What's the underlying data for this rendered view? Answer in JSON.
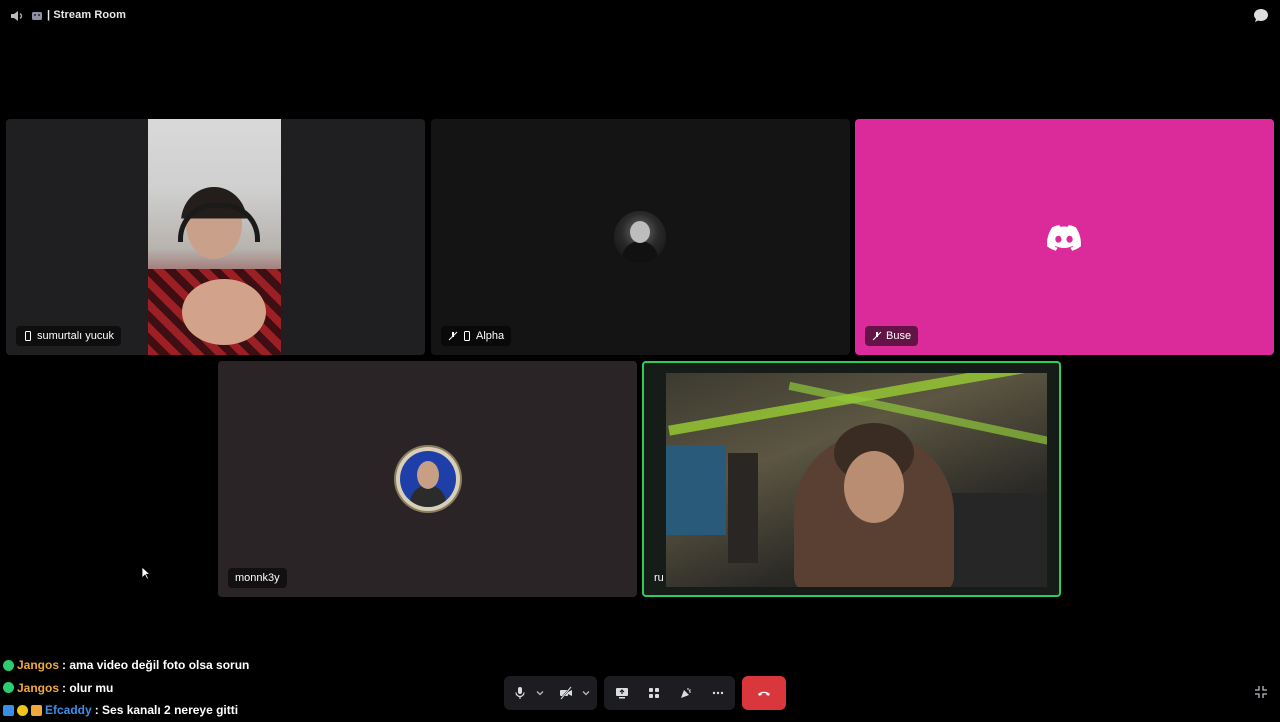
{
  "header": {
    "title": "| Stream Room"
  },
  "tiles": [
    {
      "name": "sumurtalı yucuk",
      "device": "mobile",
      "muted": false
    },
    {
      "name": "Alpha",
      "device": "mobile",
      "muted": true
    },
    {
      "name": "Buse",
      "muted": true
    },
    {
      "name": "monnk3y",
      "muted": false
    },
    {
      "name": "ru",
      "speaking": true
    }
  ],
  "colors": {
    "discord_pink": "#db2b9a",
    "speaking_ring": "#2ecc5c",
    "hangup": "#da373c"
  },
  "chat": [
    {
      "author": "Jangos",
      "author_color": "#f0a83a",
      "message": ": ama video değil foto olsa sorun"
    },
    {
      "author": "Jangos",
      "author_color": "#f0a83a",
      "message": ": olur mu"
    },
    {
      "author": "Efcaddy",
      "author_color": "#3b8ee8",
      "message": ": Ses kanalı 2 nereye gitti"
    }
  ],
  "controls": {
    "mic": "microphone-icon",
    "mic_options": "chevron-down-icon",
    "camera": "camera-off-icon",
    "camera_options": "chevron-down-icon",
    "screen_share": "screen-share-icon",
    "activities": "activities-icon",
    "soundboard": "soundboard-icon",
    "more": "more-icon",
    "disconnect": "hangup-icon"
  }
}
